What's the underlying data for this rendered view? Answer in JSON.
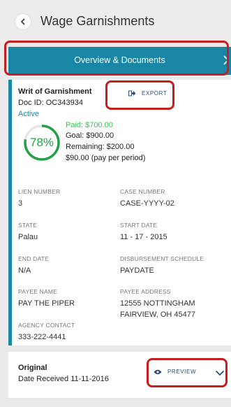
{
  "header": {
    "title": "Wage Garnishments",
    "back_icon": "chevron-left-icon"
  },
  "tab": {
    "label": "Overview & Documents",
    "next_icon": "chevron-right-icon",
    "color": "#1a86a6"
  },
  "writ": {
    "title": "Writ of Garnishment",
    "doc_id": "Doc ID: OC343934",
    "status": "Active",
    "export_label": "EXPORT",
    "export_icon": "export-icon",
    "progress": {
      "percent_label": "78%",
      "value": 0.78
    },
    "paid": "Paid: $700.00",
    "goal": "Goal: $900.00",
    "remaining": "Remaining: $200.00",
    "per_period": "$90.00 (pay per period)"
  },
  "fields": {
    "lien_number": {
      "label": "LIEN NUMBER",
      "value": "3"
    },
    "case_number": {
      "label": "CASE NUMBER",
      "value": "CASE-YYYY-02"
    },
    "state": {
      "label": "STATE",
      "value": "Palau"
    },
    "start_date": {
      "label": "START DATE",
      "value": "11 - 17 - 2015"
    },
    "end_date": {
      "label": "END DATE",
      "value": "N/A"
    },
    "disbursement": {
      "label": "DISBURSEMENT SCHEDULE",
      "value": "PAYDATE"
    },
    "payee_name": {
      "label": "PAYEE NAME",
      "value": "PAY THE PIPER"
    },
    "payee_address": {
      "label": "PAYEE ADDRESS",
      "line1": "12555 NOTTINGHAM",
      "line2": "FAIRVIEW, OH 45477"
    },
    "agency_contact": {
      "label": "AGENCY CONTACT",
      "value": "333-222-4441"
    }
  },
  "document": {
    "title": "Original",
    "date_received": "Date Received 11-11-2016",
    "preview_label": "PREVIEW",
    "preview_icon": "eye-icon",
    "expand_icon": "chevron-down-icon"
  },
  "colors": {
    "accent": "#1a86a6",
    "progress_green": "#27a04a",
    "paid_green": "#34c74d",
    "link_navy": "#2a4e79",
    "highlight_red": "#c41e1e"
  }
}
